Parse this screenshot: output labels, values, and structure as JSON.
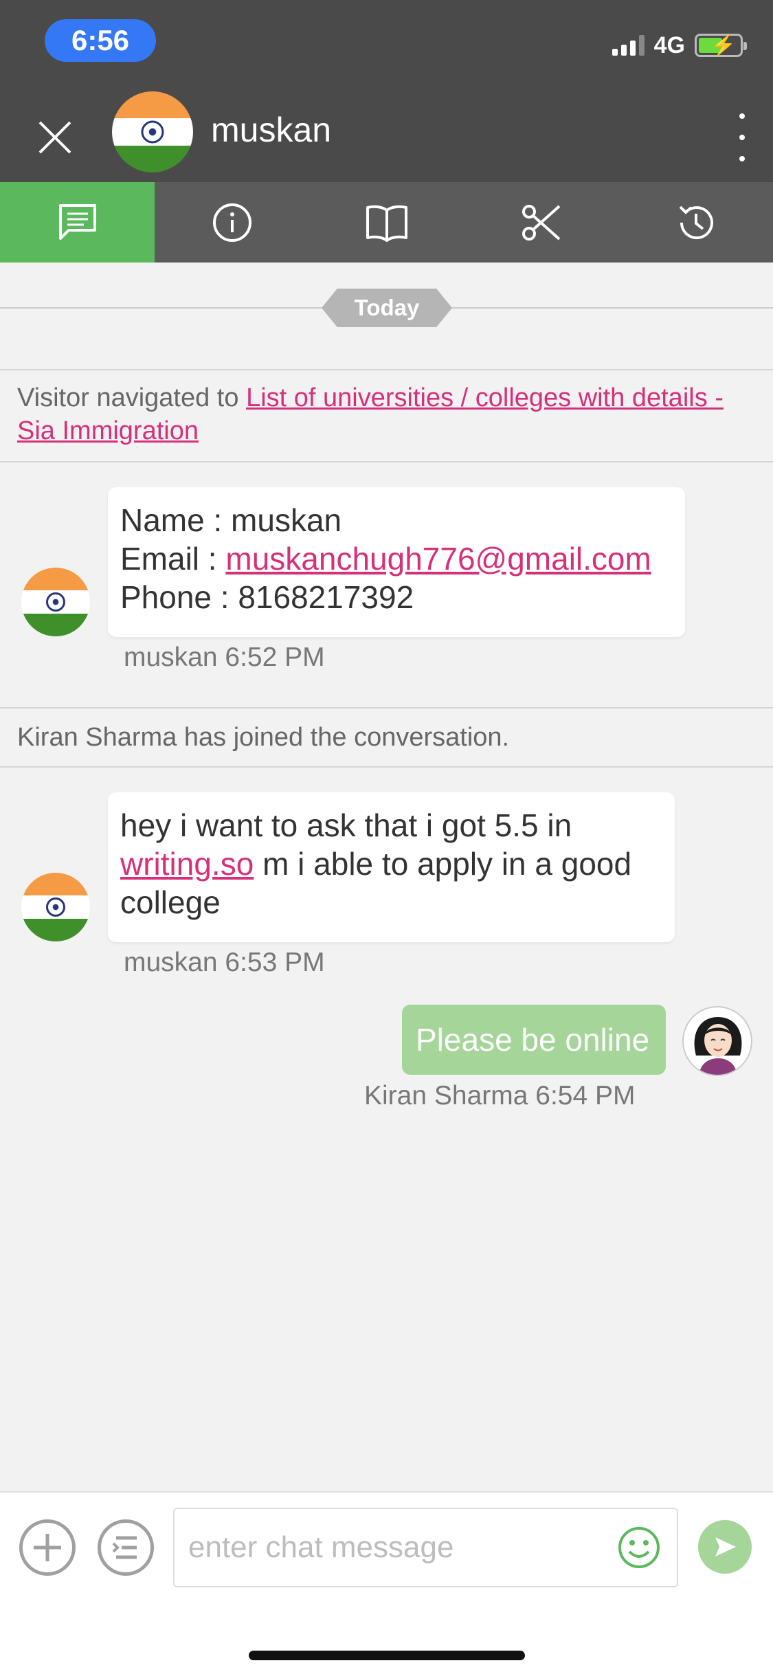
{
  "status_bar": {
    "time": "6:56",
    "network": "4G"
  },
  "header": {
    "contact_name": "muskan"
  },
  "tabs": [
    {
      "icon": "chat-icon",
      "active": true
    },
    {
      "icon": "info-icon",
      "active": false
    },
    {
      "icon": "book-icon",
      "active": false
    },
    {
      "icon": "scissors-icon",
      "active": false
    },
    {
      "icon": "history-icon",
      "active": false
    }
  ],
  "conversation": {
    "date_separator": "Today",
    "navigation": {
      "prefix": "Visitor navigated to ",
      "link": "List of universities / colleges with details - Sia Immigration"
    },
    "info_message": {
      "name_line": "Name : muskan",
      "email_label": "Email : ",
      "email": "muskanchugh776@gmail.com",
      "phone_line": "Phone : 8168217392",
      "sender": "muskan",
      "time": "6:52 PM"
    },
    "joined_notice": "Kiran Sharma has joined the conversation.",
    "visitor_message": {
      "text_before": "hey i want to ask that i got 5.5 in ",
      "link": "writing.so",
      "text_after": " m i able to apply in a good college",
      "sender": "muskan",
      "time": "6:53 PM"
    },
    "agent_message": {
      "text": "Please be online",
      "sender": "Kiran Sharma",
      "time": "6:54 PM"
    }
  },
  "composer": {
    "placeholder": "enter chat message"
  },
  "colors": {
    "accent_green": "#5cb85c",
    "link_pink": "#d6307a",
    "header_gray": "#4a4a4a"
  }
}
